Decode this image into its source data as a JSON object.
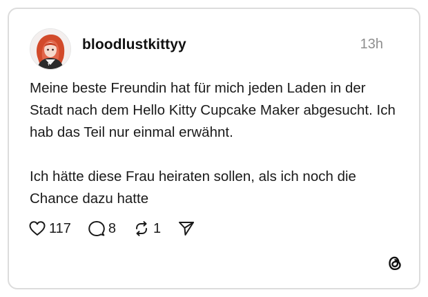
{
  "post": {
    "username": "bloodlustkittyy",
    "timestamp": "13h",
    "paragraphs": [
      "Meine beste Freundin hat für mich jeden Laden in der Stadt nach dem Hello Kitty Cupcake Maker abgesucht. Ich hab das Teil nur einmal erwähnt.",
      "Ich hätte diese Frau heiraten sollen, als ich noch die Chance dazu hatte"
    ]
  },
  "actions": {
    "likes": "117",
    "comments": "8",
    "reposts": "1"
  },
  "icons": {
    "like": "heart-icon",
    "comment": "comment-bubble-icon",
    "repost": "repost-icon",
    "share": "send-icon",
    "brand": "threads-logo"
  },
  "colors": {
    "text": "#111111",
    "muted": "#8e8e8e",
    "border": "#dcdcdc"
  }
}
